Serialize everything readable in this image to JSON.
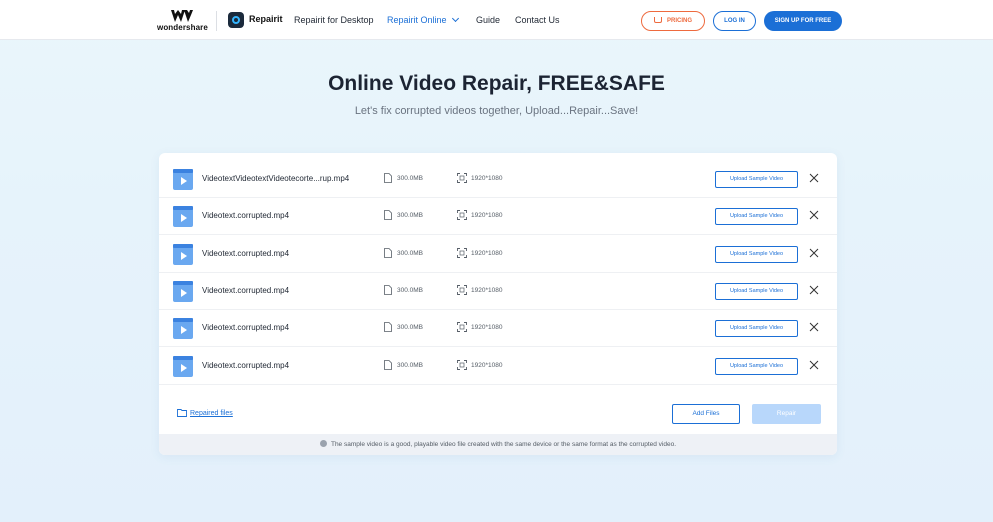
{
  "nav": {
    "brand": "wondershare",
    "product": "Repairit",
    "links": [
      "Repairit for Desktop",
      "Repairit Online",
      "Guide",
      "Contact Us"
    ],
    "pricing": "PRICING",
    "login": "LOG IN",
    "signup": "SIGN UP FOR FREE"
  },
  "hero": {
    "title": "Online Video Repair, FREE&SAFE",
    "subtitle": "Let's fix corrupted videos together, Upload...Repair...Save!"
  },
  "files": [
    {
      "name": "VideotextVideotextVideotecorte...rup.mp4",
      "size": "300.0MB",
      "resolution": "1920*1080",
      "action": "Upload Sample Video"
    },
    {
      "name": "Videotext.corrupted.mp4",
      "size": "300.0MB",
      "resolution": "1920*1080",
      "action": "Upload Sample Video"
    },
    {
      "name": "Videotext.corrupted.mp4",
      "size": "300.0MB",
      "resolution": "1920*1080",
      "action": "Upload Sample Video"
    },
    {
      "name": "Videotext.corrupted.mp4",
      "size": "300.0MB",
      "resolution": "1920*1080",
      "action": "Upload Sample Video"
    },
    {
      "name": "Videotext.corrupted.mp4",
      "size": "300.0MB",
      "resolution": "1920*1080",
      "action": "Upload Sample Video"
    },
    {
      "name": "Videotext.corrupted.mp4",
      "size": "300.0MB",
      "resolution": "1920*1080",
      "action": "Upload Sample Video"
    }
  ],
  "footer": {
    "repaired_files": "Repaired files",
    "add_files": "Add Files",
    "repair": "Repair"
  },
  "note": "The sample video is a good, playable video file created with the same device or the same format as the corrupted video.",
  "colors": {
    "accent": "#1b6fd6",
    "pricing": "#ee6a3e",
    "repair_disabled": "#b8d7fb"
  },
  "icons": {
    "video_file": "video-file-icon",
    "size": "document-icon",
    "resolution": "expand-icon",
    "remove": "close-icon",
    "folder": "folder-icon",
    "info": "info-icon",
    "cart": "cart-icon"
  }
}
